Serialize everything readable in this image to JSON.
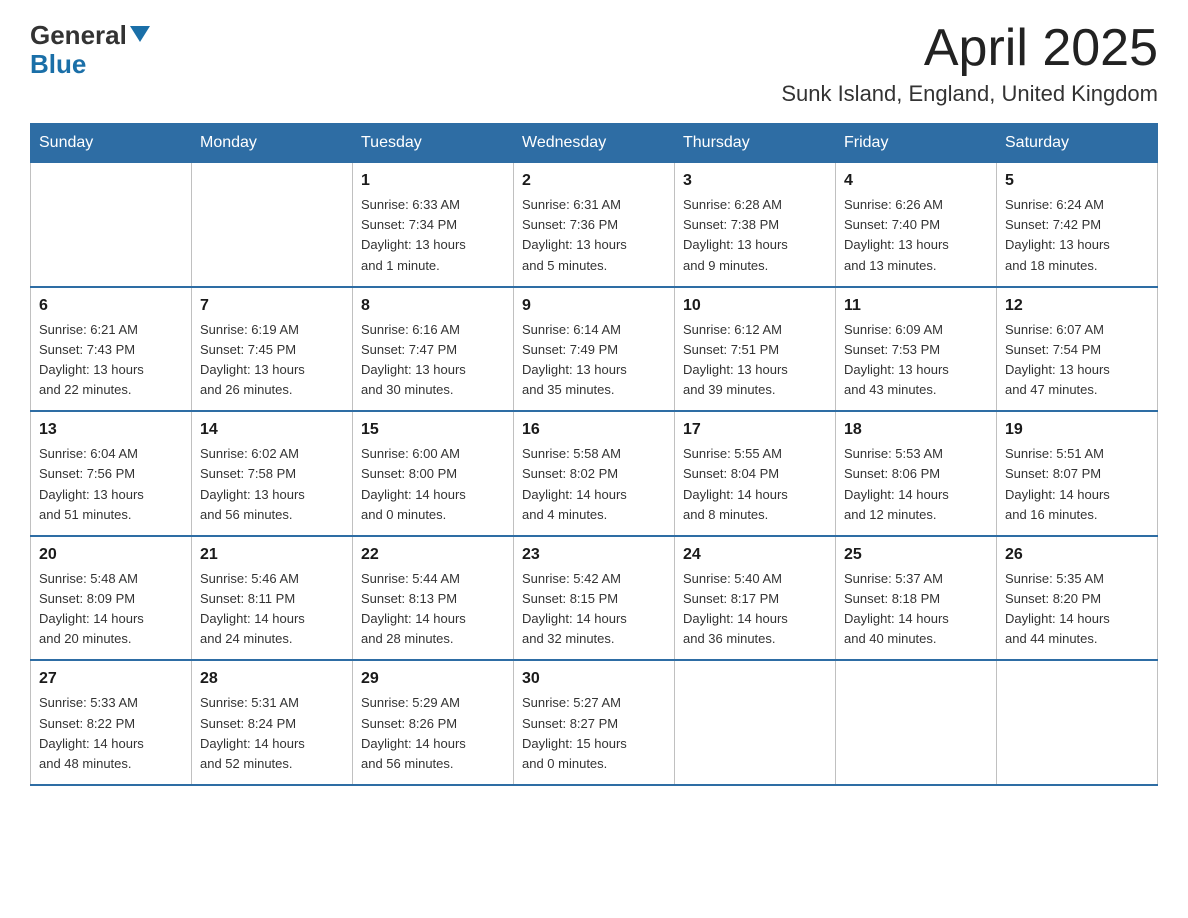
{
  "header": {
    "logo_general": "General",
    "logo_blue": "Blue",
    "month_title": "April 2025",
    "location": "Sunk Island, England, United Kingdom"
  },
  "days_of_week": [
    "Sunday",
    "Monday",
    "Tuesday",
    "Wednesday",
    "Thursday",
    "Friday",
    "Saturday"
  ],
  "weeks": [
    [
      {
        "day": "",
        "info": ""
      },
      {
        "day": "",
        "info": ""
      },
      {
        "day": "1",
        "info": "Sunrise: 6:33 AM\nSunset: 7:34 PM\nDaylight: 13 hours\nand 1 minute."
      },
      {
        "day": "2",
        "info": "Sunrise: 6:31 AM\nSunset: 7:36 PM\nDaylight: 13 hours\nand 5 minutes."
      },
      {
        "day": "3",
        "info": "Sunrise: 6:28 AM\nSunset: 7:38 PM\nDaylight: 13 hours\nand 9 minutes."
      },
      {
        "day": "4",
        "info": "Sunrise: 6:26 AM\nSunset: 7:40 PM\nDaylight: 13 hours\nand 13 minutes."
      },
      {
        "day": "5",
        "info": "Sunrise: 6:24 AM\nSunset: 7:42 PM\nDaylight: 13 hours\nand 18 minutes."
      }
    ],
    [
      {
        "day": "6",
        "info": "Sunrise: 6:21 AM\nSunset: 7:43 PM\nDaylight: 13 hours\nand 22 minutes."
      },
      {
        "day": "7",
        "info": "Sunrise: 6:19 AM\nSunset: 7:45 PM\nDaylight: 13 hours\nand 26 minutes."
      },
      {
        "day": "8",
        "info": "Sunrise: 6:16 AM\nSunset: 7:47 PM\nDaylight: 13 hours\nand 30 minutes."
      },
      {
        "day": "9",
        "info": "Sunrise: 6:14 AM\nSunset: 7:49 PM\nDaylight: 13 hours\nand 35 minutes."
      },
      {
        "day": "10",
        "info": "Sunrise: 6:12 AM\nSunset: 7:51 PM\nDaylight: 13 hours\nand 39 minutes."
      },
      {
        "day": "11",
        "info": "Sunrise: 6:09 AM\nSunset: 7:53 PM\nDaylight: 13 hours\nand 43 minutes."
      },
      {
        "day": "12",
        "info": "Sunrise: 6:07 AM\nSunset: 7:54 PM\nDaylight: 13 hours\nand 47 minutes."
      }
    ],
    [
      {
        "day": "13",
        "info": "Sunrise: 6:04 AM\nSunset: 7:56 PM\nDaylight: 13 hours\nand 51 minutes."
      },
      {
        "day": "14",
        "info": "Sunrise: 6:02 AM\nSunset: 7:58 PM\nDaylight: 13 hours\nand 56 minutes."
      },
      {
        "day": "15",
        "info": "Sunrise: 6:00 AM\nSunset: 8:00 PM\nDaylight: 14 hours\nand 0 minutes."
      },
      {
        "day": "16",
        "info": "Sunrise: 5:58 AM\nSunset: 8:02 PM\nDaylight: 14 hours\nand 4 minutes."
      },
      {
        "day": "17",
        "info": "Sunrise: 5:55 AM\nSunset: 8:04 PM\nDaylight: 14 hours\nand 8 minutes."
      },
      {
        "day": "18",
        "info": "Sunrise: 5:53 AM\nSunset: 8:06 PM\nDaylight: 14 hours\nand 12 minutes."
      },
      {
        "day": "19",
        "info": "Sunrise: 5:51 AM\nSunset: 8:07 PM\nDaylight: 14 hours\nand 16 minutes."
      }
    ],
    [
      {
        "day": "20",
        "info": "Sunrise: 5:48 AM\nSunset: 8:09 PM\nDaylight: 14 hours\nand 20 minutes."
      },
      {
        "day": "21",
        "info": "Sunrise: 5:46 AM\nSunset: 8:11 PM\nDaylight: 14 hours\nand 24 minutes."
      },
      {
        "day": "22",
        "info": "Sunrise: 5:44 AM\nSunset: 8:13 PM\nDaylight: 14 hours\nand 28 minutes."
      },
      {
        "day": "23",
        "info": "Sunrise: 5:42 AM\nSunset: 8:15 PM\nDaylight: 14 hours\nand 32 minutes."
      },
      {
        "day": "24",
        "info": "Sunrise: 5:40 AM\nSunset: 8:17 PM\nDaylight: 14 hours\nand 36 minutes."
      },
      {
        "day": "25",
        "info": "Sunrise: 5:37 AM\nSunset: 8:18 PM\nDaylight: 14 hours\nand 40 minutes."
      },
      {
        "day": "26",
        "info": "Sunrise: 5:35 AM\nSunset: 8:20 PM\nDaylight: 14 hours\nand 44 minutes."
      }
    ],
    [
      {
        "day": "27",
        "info": "Sunrise: 5:33 AM\nSunset: 8:22 PM\nDaylight: 14 hours\nand 48 minutes."
      },
      {
        "day": "28",
        "info": "Sunrise: 5:31 AM\nSunset: 8:24 PM\nDaylight: 14 hours\nand 52 minutes."
      },
      {
        "day": "29",
        "info": "Sunrise: 5:29 AM\nSunset: 8:26 PM\nDaylight: 14 hours\nand 56 minutes."
      },
      {
        "day": "30",
        "info": "Sunrise: 5:27 AM\nSunset: 8:27 PM\nDaylight: 15 hours\nand 0 minutes."
      },
      {
        "day": "",
        "info": ""
      },
      {
        "day": "",
        "info": ""
      },
      {
        "day": "",
        "info": ""
      }
    ]
  ]
}
